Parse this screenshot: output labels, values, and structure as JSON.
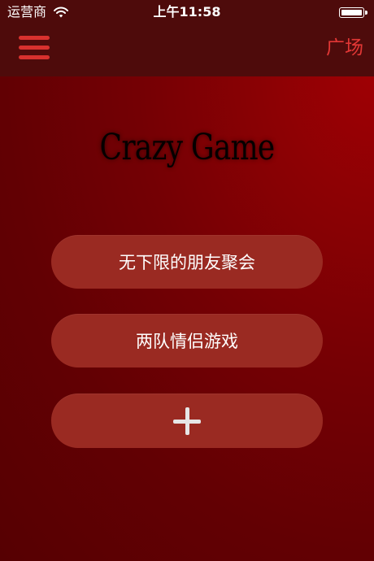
{
  "status_bar": {
    "carrier": "运营商",
    "time": "上午11:58",
    "wifi_icon": "wifi-icon",
    "battery_icon": "battery-full-icon"
  },
  "nav": {
    "menu_icon": "hamburger-menu-icon",
    "right_link": "广场"
  },
  "title": "Crazy Game",
  "menu": {
    "items": [
      {
        "label": "无下限的朋友聚会"
      },
      {
        "label": "两队情侣游戏"
      }
    ],
    "add_icon": "plus-icon"
  },
  "colors": {
    "bar_background": "#4e0b0b",
    "accent": "#e23735",
    "button_background": "#9a2a22",
    "page_background": "#6a0003"
  }
}
